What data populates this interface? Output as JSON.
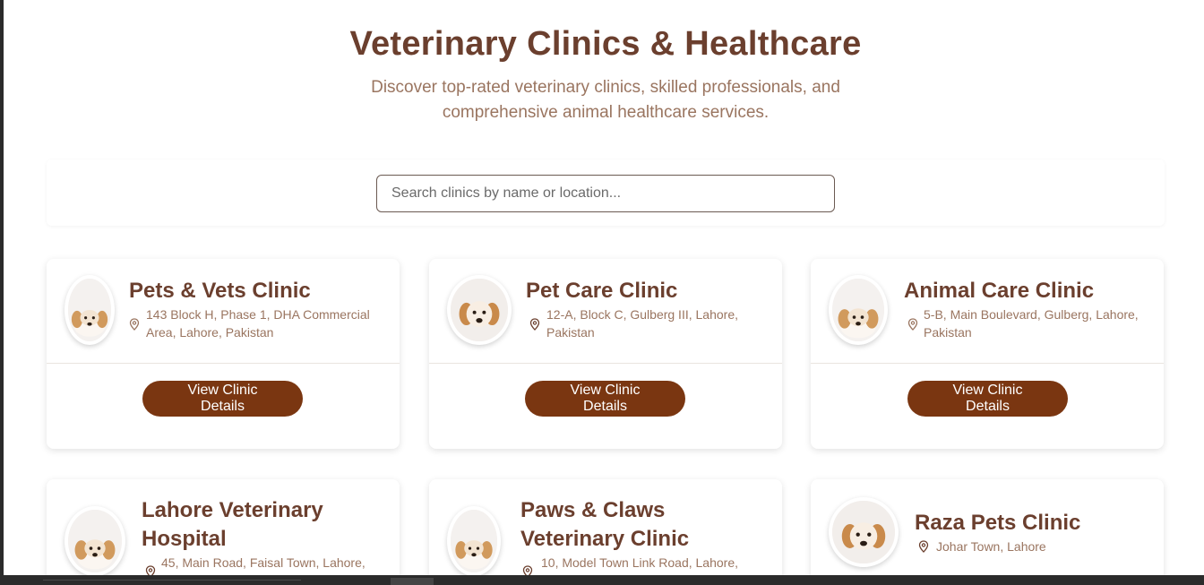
{
  "header": {
    "title": "Veterinary Clinics & Healthcare",
    "subtitle_line1": "Discover top-rated veterinary clinics, skilled professionals, and",
    "subtitle_line2": "comprehensive animal healthcare services."
  },
  "search": {
    "placeholder": "Search clinics by name or location...",
    "value": ""
  },
  "clinics": [
    {
      "name": "Pets & Vets Clinic",
      "address_line1": "143 Block H, Phase 1, DHA Commercial",
      "address_line2": "Area, Lahore, Pakistan",
      "button": "View Clinic Details"
    },
    {
      "name": "Pet Care Clinic",
      "address_line1": "12-A, Block C, Gulberg III, Lahore,",
      "address_line2": "Pakistan",
      "button": "View Clinic Details"
    },
    {
      "name": "Animal Care Clinic",
      "address_line1": "5-B, Main Boulevard, Gulberg, Lahore,",
      "address_line2": "Pakistan",
      "button": "View Clinic Details"
    },
    {
      "name_line1": "Lahore Veterinary",
      "name_line2": "Hospital",
      "address_line1": "45, Main Road, Faisal Town, Lahore,"
    },
    {
      "name_line1": "Paws & Claws",
      "name_line2": "Veterinary Clinic",
      "address_line1": "10, Model Town Link Road, Lahore,"
    },
    {
      "name": "Raza Pets Clinic",
      "address_line1": "Johar Town, Lahore"
    }
  ],
  "icons": {
    "pin": "map-pin-icon",
    "avatar": "puppy-avatar"
  },
  "colors": {
    "brand": "#6b3f2e",
    "accent_button": "#7a3611",
    "muted_text": "#9a7560"
  }
}
